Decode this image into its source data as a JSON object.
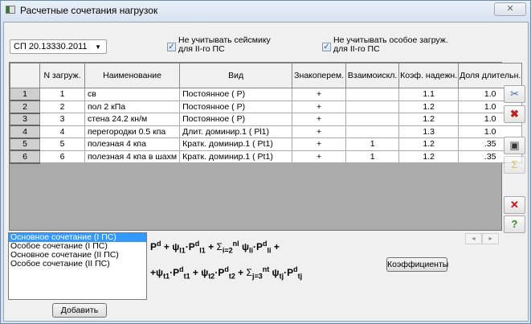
{
  "window": {
    "title": "Расчетные сочетания нагрузок",
    "close_icon": "close-icon"
  },
  "norm_select": {
    "value": "СП 20.13330.2011"
  },
  "checkboxes": [
    {
      "label_line1": "Не учитывать сейсмику",
      "label_line2": "для II-го ПС",
      "checked": true
    },
    {
      "label_line1": "Не учитывать особое загруж.",
      "label_line2": "для II-го ПС",
      "checked": true
    }
  ],
  "table": {
    "columns": [
      "",
      "N загруж.",
      "Наименование",
      "Вид",
      "Знакоперем.",
      "Взаимоискл.",
      "Коэф. надежн.",
      "Доля длительн."
    ],
    "rows": [
      [
        "1",
        "1",
        "св",
        "Постоянное ( P)",
        "+",
        "",
        "1.1",
        "1.0"
      ],
      [
        "2",
        "2",
        "пол 2 кПа",
        "Постоянное ( P)",
        "+",
        "",
        "1.2",
        "1.0"
      ],
      [
        "3",
        "3",
        "стена 24.2 кн/м",
        "Постоянное ( P)",
        "+",
        "",
        "1.2",
        "1.0"
      ],
      [
        "4",
        "4",
        "перегородки 0.5 кпа",
        "Длит. доминир.1 ( Pl1)",
        "+",
        "",
        "1.3",
        "1.0"
      ],
      [
        "5",
        "5",
        "полезная 4 кпа",
        "Кратк. доминир.1 ( Pt1)",
        "+",
        "1",
        "1.2",
        ".35"
      ],
      [
        "6",
        "6",
        "полезная 4 кпа в шахм",
        "Кратк. доминир.1 ( Pt1)",
        "+",
        "1",
        "1.2",
        ".35"
      ]
    ]
  },
  "combinations": {
    "items": [
      "Основное сочетание (I ПС)",
      "Особое сочетание (I ПС)",
      "Основное сочетание (II ПС)",
      "Особое сочетание (II ПС)"
    ],
    "selected": 0
  },
  "buttons": {
    "add": "Добавить",
    "coefficients": "Коэффициенты"
  },
  "formula": {
    "line1": "Pd + ψl1·Pdl1 + Σ(i=2..nl) ψli·Pdli +",
    "line2": "+ψt1·Pdt1 + ψt2·Pdt2 + Σ(j=3..nt) ψtj·Pdtj"
  }
}
